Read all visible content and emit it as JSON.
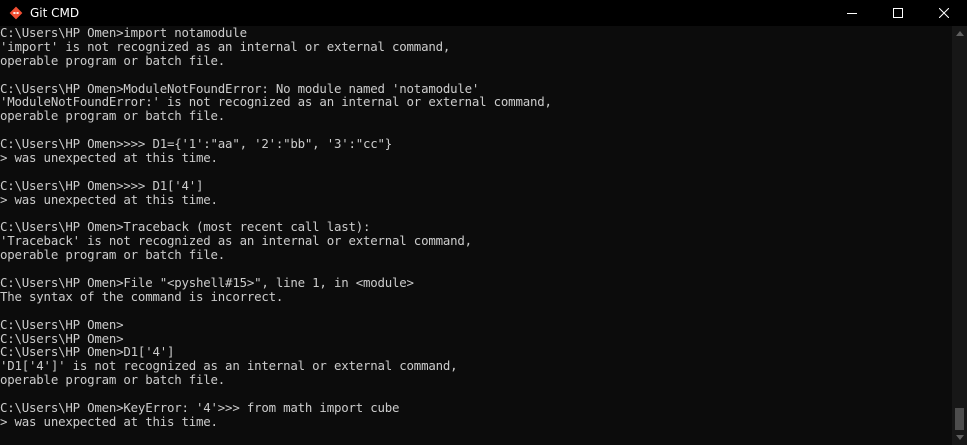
{
  "window": {
    "title": "Git CMD",
    "icon": "git-diamond-icon",
    "accent_color": "#f14e32",
    "background_color": "#0c0c0c",
    "text_color": "#cccccc"
  },
  "controls": {
    "minimize_icon": "minimize-icon",
    "maximize_icon": "maximize-icon",
    "close_icon": "close-icon"
  },
  "terminal": {
    "lines": [
      "C:\\Users\\HP Omen>import notamodule",
      "'import' is not recognized as an internal or external command,",
      "operable program or batch file.",
      "",
      "C:\\Users\\HP Omen>ModuleNotFoundError: No module named 'notamodule'",
      "'ModuleNotFoundError:' is not recognized as an internal or external command,",
      "operable program or batch file.",
      "",
      "C:\\Users\\HP Omen>>>> D1={'1':\"aa\", '2':\"bb\", '3':\"cc\"}",
      "> was unexpected at this time.",
      "",
      "C:\\Users\\HP Omen>>>> D1['4']",
      "> was unexpected at this time.",
      "",
      "C:\\Users\\HP Omen>Traceback (most recent call last):",
      "'Traceback' is not recognized as an internal or external command,",
      "operable program or batch file.",
      "",
      "C:\\Users\\HP Omen>File \"<pyshell#15>\", line 1, in <module>",
      "The syntax of the command is incorrect.",
      "",
      "C:\\Users\\HP Omen>",
      "C:\\Users\\HP Omen>",
      "C:\\Users\\HP Omen>D1['4']",
      "'D1['4']' is not recognized as an internal or external command,",
      "operable program or batch file.",
      "",
      "C:\\Users\\HP Omen>KeyError: '4'>>> from math import cube",
      "> was unexpected at this time."
    ]
  },
  "scrollbar": {
    "position_fraction": 1.0
  }
}
